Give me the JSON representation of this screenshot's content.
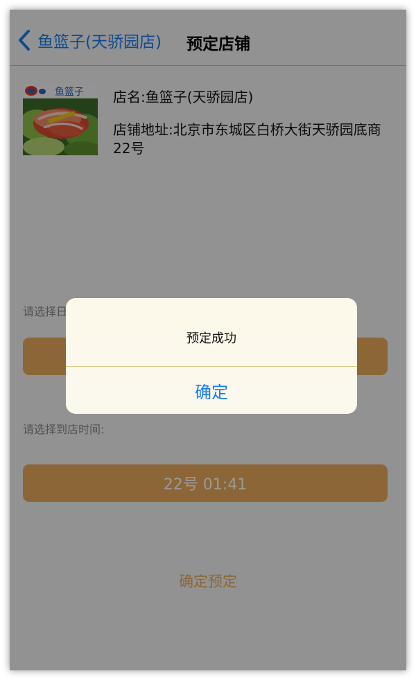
{
  "navbar": {
    "back_label": "鱼篮子(天骄园店)",
    "title": "预定店铺"
  },
  "shop": {
    "logo_text": "鱼篮子",
    "name": "店名:鱼篮子(天骄园店)",
    "address": "店铺地址:北京市东城区白桥大街天骄园底商22号"
  },
  "reservation": {
    "date_label": "请选择日期:",
    "time_label": "请选择到店时间:",
    "time_value": "22号 01:41",
    "confirm_label": "确定预定"
  },
  "dialog": {
    "message": "预定成功",
    "ok_label": "确定"
  },
  "colors": {
    "accent": "#1a7cf0",
    "button_orange": "#e9aa5a",
    "overlay": "rgba(0,0,0,0.40)"
  }
}
